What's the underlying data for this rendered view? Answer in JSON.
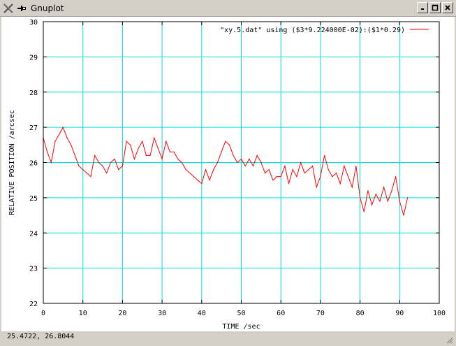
{
  "window": {
    "title": "Gnuplot",
    "close_icon": "x-close-icon",
    "pin_icon": "pin-icon",
    "buttons": [
      "minimize-icon",
      "maximize-icon",
      "close-icon"
    ]
  },
  "status": {
    "coords": "25.4722,  26.8044"
  },
  "colors": {
    "grid": "#00e0e0",
    "series": "#ff0000",
    "frame": "#000000"
  },
  "chart_data": {
    "type": "line",
    "xlabel": "TIME /sec",
    "ylabel": "RELATIVE POSITION /arcsec",
    "xlim": [
      0,
      100
    ],
    "ylim": [
      22,
      30
    ],
    "xticks": [
      0,
      10,
      20,
      30,
      40,
      50,
      60,
      70,
      80,
      90,
      100
    ],
    "yticks": [
      22,
      23,
      24,
      25,
      26,
      27,
      28,
      29,
      30
    ],
    "grid": true,
    "legend_position": "top-right",
    "series": [
      {
        "name": "\"xy.5.dat\" using ($3*9.224000E-02):($1*0.29)",
        "x": [
          0,
          1,
          2,
          3,
          4,
          5,
          6,
          7,
          8,
          9,
          10,
          11,
          12,
          13,
          14,
          15,
          16,
          17,
          18,
          19,
          20,
          21,
          22,
          23,
          24,
          25,
          26,
          27,
          28,
          29,
          30,
          31,
          32,
          33,
          34,
          35,
          36,
          37,
          38,
          39,
          40,
          41,
          42,
          43,
          44,
          45,
          46,
          47,
          48,
          49,
          50,
          51,
          52,
          53,
          54,
          55,
          56,
          57,
          58,
          59,
          60,
          61,
          62,
          63,
          64,
          65,
          66,
          67,
          68,
          69,
          70,
          71,
          72,
          73,
          74,
          75,
          76,
          77,
          78,
          79,
          80,
          81,
          82,
          83,
          84,
          85,
          86,
          87,
          88,
          89,
          90,
          91,
          92
        ],
        "y": [
          26.7,
          26.3,
          26.0,
          26.6,
          26.8,
          27.0,
          26.7,
          26.5,
          26.2,
          25.9,
          25.8,
          25.7,
          25.6,
          26.2,
          26.0,
          25.9,
          25.7,
          26.0,
          26.1,
          25.8,
          25.9,
          26.6,
          26.5,
          26.1,
          26.4,
          26.6,
          26.2,
          26.2,
          26.7,
          26.4,
          26.1,
          26.6,
          26.3,
          26.3,
          26.1,
          26.0,
          25.8,
          25.7,
          25.6,
          25.5,
          25.4,
          25.8,
          25.5,
          25.8,
          26.0,
          26.3,
          26.6,
          26.5,
          26.2,
          26.0,
          26.1,
          25.9,
          26.1,
          25.9,
          26.2,
          26.0,
          25.7,
          25.8,
          25.5,
          25.6,
          25.6,
          25.9,
          25.4,
          25.8,
          25.6,
          26.0,
          25.7,
          25.8,
          25.9,
          25.3,
          25.6,
          26.2,
          25.8,
          25.6,
          25.7,
          25.4,
          25.9,
          25.6,
          25.3,
          25.9,
          25.0,
          24.6,
          25.2,
          24.8,
          25.1,
          24.9,
          25.3,
          24.9,
          25.2,
          25.6,
          24.9,
          24.5,
          25.0
        ]
      }
    ]
  }
}
